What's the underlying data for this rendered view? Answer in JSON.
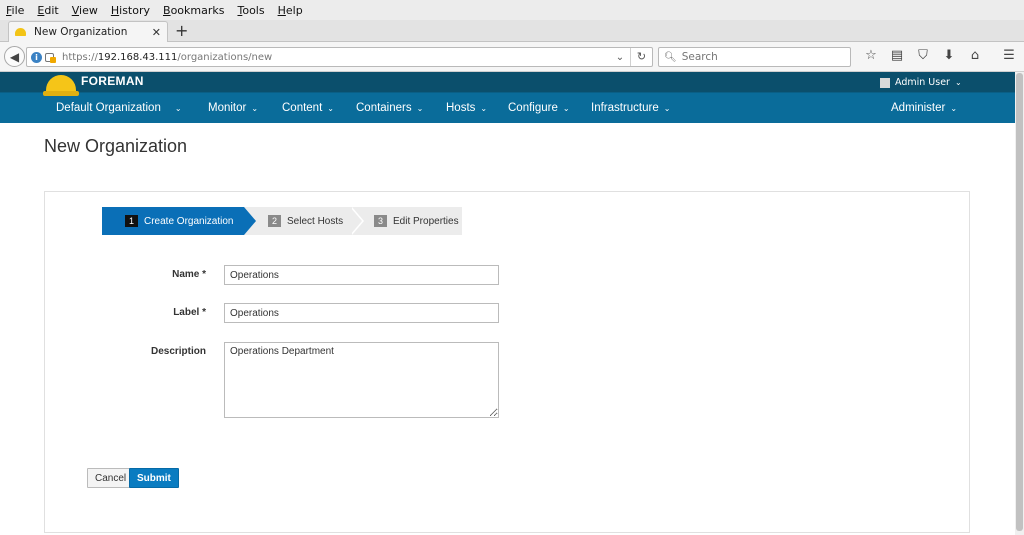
{
  "browser": {
    "menu": [
      "File",
      "Edit",
      "View",
      "History",
      "Bookmarks",
      "Tools",
      "Help"
    ],
    "tab_title": "New Organization",
    "tab_close": "✕",
    "new_tab": "+",
    "url_prefix": "https://",
    "url_host": "192.168.43.111",
    "url_path": "/organizations/new",
    "search_placeholder": "Search"
  },
  "app": {
    "brand": "FOREMAN",
    "user": "Admin User",
    "nav": [
      "Default Organization",
      "Monitor",
      "Content",
      "Containers",
      "Hosts",
      "Configure",
      "Infrastructure",
      "Administer"
    ]
  },
  "page": {
    "title": "New Organization",
    "wizard": [
      {
        "num": "1",
        "label": "Create Organization"
      },
      {
        "num": "2",
        "label": "Select Hosts"
      },
      {
        "num": "3",
        "label": "Edit Properties"
      }
    ],
    "form": {
      "name_label": "Name *",
      "name_value": "Operations",
      "label_label": "Label *",
      "label_value": "Operations",
      "description_label": "Description",
      "description_value": "Operations Department"
    },
    "cancel": "Cancel",
    "submit": "Submit"
  },
  "colors": {
    "header_dark": "#0b4f6c",
    "header_nav": "#0a6c9a",
    "wizard_active": "#0a6fb7",
    "submit": "#0a7cc1"
  }
}
